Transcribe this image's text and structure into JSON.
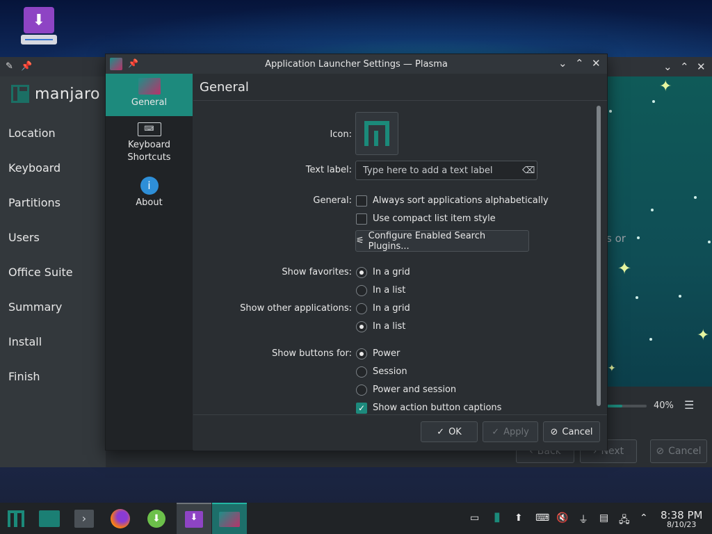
{
  "installer": {
    "logo_text": "manjaro",
    "steps": [
      "Location",
      "Keyboard",
      "Partitions",
      "Users",
      "Office Suite",
      "Summary",
      "Install",
      "Finish"
    ],
    "partial_text": "s or",
    "progress_percent": "40%",
    "progress_value": 40,
    "back_label": "Back",
    "next_label": "Next",
    "cancel_label": "Cancel"
  },
  "dialog": {
    "title": "Application Launcher Settings — Plasma",
    "sidebar": [
      {
        "label": "General",
        "icon": "launcher-icon"
      },
      {
        "label": "Keyboard\nShortcuts",
        "icon": "keyboard-icon"
      },
      {
        "label": "About",
        "icon": "info-icon"
      }
    ],
    "page_title": "General",
    "form": {
      "icon_label": "Icon:",
      "text_label": "Text label:",
      "text_placeholder": "Type here to add a text label",
      "general_label": "General:",
      "sort_alpha": "Always sort applications alphabetically",
      "compact_list": "Use compact list item style",
      "configure_plugins": "Configure Enabled Search Plugins...",
      "show_favorites_label": "Show favorites:",
      "fav_grid": "In a grid",
      "fav_list": "In a list",
      "show_other_label": "Show other applications:",
      "other_grid": "In a grid",
      "other_list": "In a list",
      "show_buttons_label": "Show buttons for:",
      "btn_power": "Power",
      "btn_session": "Session",
      "btn_power_session": "Power and session",
      "show_captions": "Show action button captions"
    },
    "footer": {
      "ok_label": "OK",
      "apply_label": "Apply",
      "cancel_label": "Cancel"
    }
  },
  "taskbar": {
    "time": "8:38 PM",
    "date": "8/10/23"
  },
  "colors": {
    "accent": "#1d8a7d",
    "dialog_bg": "#2a2e32",
    "sidebar_bg": "#202326"
  }
}
